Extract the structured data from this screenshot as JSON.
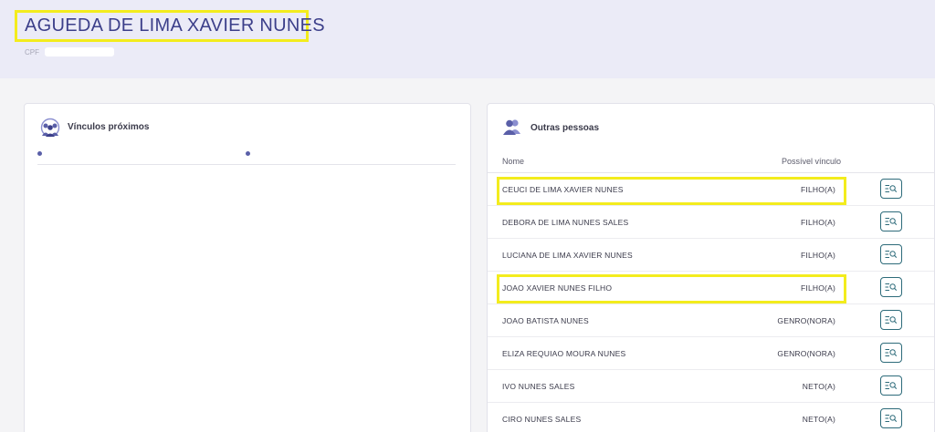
{
  "person": {
    "name": "AGUEDA DE LIMA XAVIER NUNES",
    "cpf_label": "CPF"
  },
  "vinculos": {
    "title": "Vínculos próximos",
    "icon": "people-circle-icon"
  },
  "outras": {
    "title": "Outras pessoas",
    "icon": "people-icon",
    "col_name": "Nome",
    "col_rel": "Possível vínculo",
    "rows": [
      {
        "name": "CEUCI DE LIMA XAVIER NUNES",
        "rel": "FILHO(A)"
      },
      {
        "name": "DEBORA DE LIMA NUNES SALES",
        "rel": "FILHO(A)"
      },
      {
        "name": "LUCIANA DE LIMA XAVIER NUNES",
        "rel": "FILHO(A)"
      },
      {
        "name": "JOAO XAVIER NUNES FILHO",
        "rel": "FILHO(A)"
      },
      {
        "name": "JOAO BATISTA NUNES",
        "rel": "GENRO(NORA)"
      },
      {
        "name": "ELIZA REQUIAO MOURA NUNES",
        "rel": "GENRO(NORA)"
      },
      {
        "name": "IVO NUNES SALES",
        "rel": "NETO(A)"
      },
      {
        "name": "CIRO NUNES SALES",
        "rel": "NETO(A)"
      }
    ],
    "row_button_icon": "list-search-icon"
  },
  "colors": {
    "highlight": "#f3ec1d",
    "title": "#3c3f8a",
    "accent": "#5a5fa8",
    "button_border": "#2d6b7a"
  }
}
